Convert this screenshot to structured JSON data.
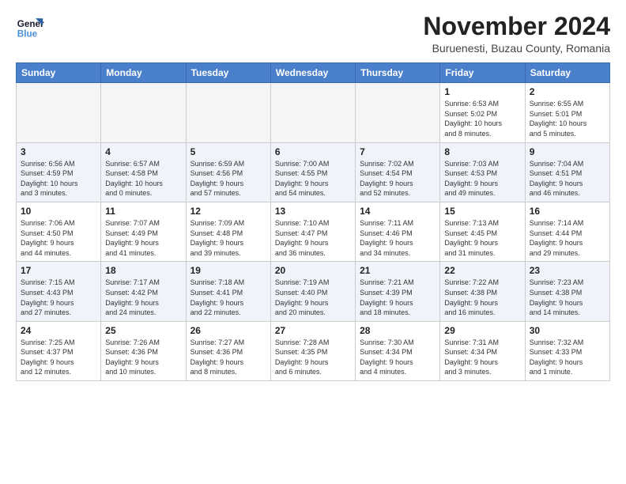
{
  "logo": {
    "line1": "General",
    "line2": "Blue"
  },
  "title": "November 2024",
  "subtitle": "Buruenesti, Buzau County, Romania",
  "weekdays": [
    "Sunday",
    "Monday",
    "Tuesday",
    "Wednesday",
    "Thursday",
    "Friday",
    "Saturday"
  ],
  "weeks": [
    [
      {
        "day": "",
        "info": ""
      },
      {
        "day": "",
        "info": ""
      },
      {
        "day": "",
        "info": ""
      },
      {
        "day": "",
        "info": ""
      },
      {
        "day": "",
        "info": ""
      },
      {
        "day": "1",
        "info": "Sunrise: 6:53 AM\nSunset: 5:02 PM\nDaylight: 10 hours\nand 8 minutes."
      },
      {
        "day": "2",
        "info": "Sunrise: 6:55 AM\nSunset: 5:01 PM\nDaylight: 10 hours\nand 5 minutes."
      }
    ],
    [
      {
        "day": "3",
        "info": "Sunrise: 6:56 AM\nSunset: 4:59 PM\nDaylight: 10 hours\nand 3 minutes."
      },
      {
        "day": "4",
        "info": "Sunrise: 6:57 AM\nSunset: 4:58 PM\nDaylight: 10 hours\nand 0 minutes."
      },
      {
        "day": "5",
        "info": "Sunrise: 6:59 AM\nSunset: 4:56 PM\nDaylight: 9 hours\nand 57 minutes."
      },
      {
        "day": "6",
        "info": "Sunrise: 7:00 AM\nSunset: 4:55 PM\nDaylight: 9 hours\nand 54 minutes."
      },
      {
        "day": "7",
        "info": "Sunrise: 7:02 AM\nSunset: 4:54 PM\nDaylight: 9 hours\nand 52 minutes."
      },
      {
        "day": "8",
        "info": "Sunrise: 7:03 AM\nSunset: 4:53 PM\nDaylight: 9 hours\nand 49 minutes."
      },
      {
        "day": "9",
        "info": "Sunrise: 7:04 AM\nSunset: 4:51 PM\nDaylight: 9 hours\nand 46 minutes."
      }
    ],
    [
      {
        "day": "10",
        "info": "Sunrise: 7:06 AM\nSunset: 4:50 PM\nDaylight: 9 hours\nand 44 minutes."
      },
      {
        "day": "11",
        "info": "Sunrise: 7:07 AM\nSunset: 4:49 PM\nDaylight: 9 hours\nand 41 minutes."
      },
      {
        "day": "12",
        "info": "Sunrise: 7:09 AM\nSunset: 4:48 PM\nDaylight: 9 hours\nand 39 minutes."
      },
      {
        "day": "13",
        "info": "Sunrise: 7:10 AM\nSunset: 4:47 PM\nDaylight: 9 hours\nand 36 minutes."
      },
      {
        "day": "14",
        "info": "Sunrise: 7:11 AM\nSunset: 4:46 PM\nDaylight: 9 hours\nand 34 minutes."
      },
      {
        "day": "15",
        "info": "Sunrise: 7:13 AM\nSunset: 4:45 PM\nDaylight: 9 hours\nand 31 minutes."
      },
      {
        "day": "16",
        "info": "Sunrise: 7:14 AM\nSunset: 4:44 PM\nDaylight: 9 hours\nand 29 minutes."
      }
    ],
    [
      {
        "day": "17",
        "info": "Sunrise: 7:15 AM\nSunset: 4:43 PM\nDaylight: 9 hours\nand 27 minutes."
      },
      {
        "day": "18",
        "info": "Sunrise: 7:17 AM\nSunset: 4:42 PM\nDaylight: 9 hours\nand 24 minutes."
      },
      {
        "day": "19",
        "info": "Sunrise: 7:18 AM\nSunset: 4:41 PM\nDaylight: 9 hours\nand 22 minutes."
      },
      {
        "day": "20",
        "info": "Sunrise: 7:19 AM\nSunset: 4:40 PM\nDaylight: 9 hours\nand 20 minutes."
      },
      {
        "day": "21",
        "info": "Sunrise: 7:21 AM\nSunset: 4:39 PM\nDaylight: 9 hours\nand 18 minutes."
      },
      {
        "day": "22",
        "info": "Sunrise: 7:22 AM\nSunset: 4:38 PM\nDaylight: 9 hours\nand 16 minutes."
      },
      {
        "day": "23",
        "info": "Sunrise: 7:23 AM\nSunset: 4:38 PM\nDaylight: 9 hours\nand 14 minutes."
      }
    ],
    [
      {
        "day": "24",
        "info": "Sunrise: 7:25 AM\nSunset: 4:37 PM\nDaylight: 9 hours\nand 12 minutes."
      },
      {
        "day": "25",
        "info": "Sunrise: 7:26 AM\nSunset: 4:36 PM\nDaylight: 9 hours\nand 10 minutes."
      },
      {
        "day": "26",
        "info": "Sunrise: 7:27 AM\nSunset: 4:36 PM\nDaylight: 9 hours\nand 8 minutes."
      },
      {
        "day": "27",
        "info": "Sunrise: 7:28 AM\nSunset: 4:35 PM\nDaylight: 9 hours\nand 6 minutes."
      },
      {
        "day": "28",
        "info": "Sunrise: 7:30 AM\nSunset: 4:34 PM\nDaylight: 9 hours\nand 4 minutes."
      },
      {
        "day": "29",
        "info": "Sunrise: 7:31 AM\nSunset: 4:34 PM\nDaylight: 9 hours\nand 3 minutes."
      },
      {
        "day": "30",
        "info": "Sunrise: 7:32 AM\nSunset: 4:33 PM\nDaylight: 9 hours\nand 1 minute."
      }
    ]
  ]
}
